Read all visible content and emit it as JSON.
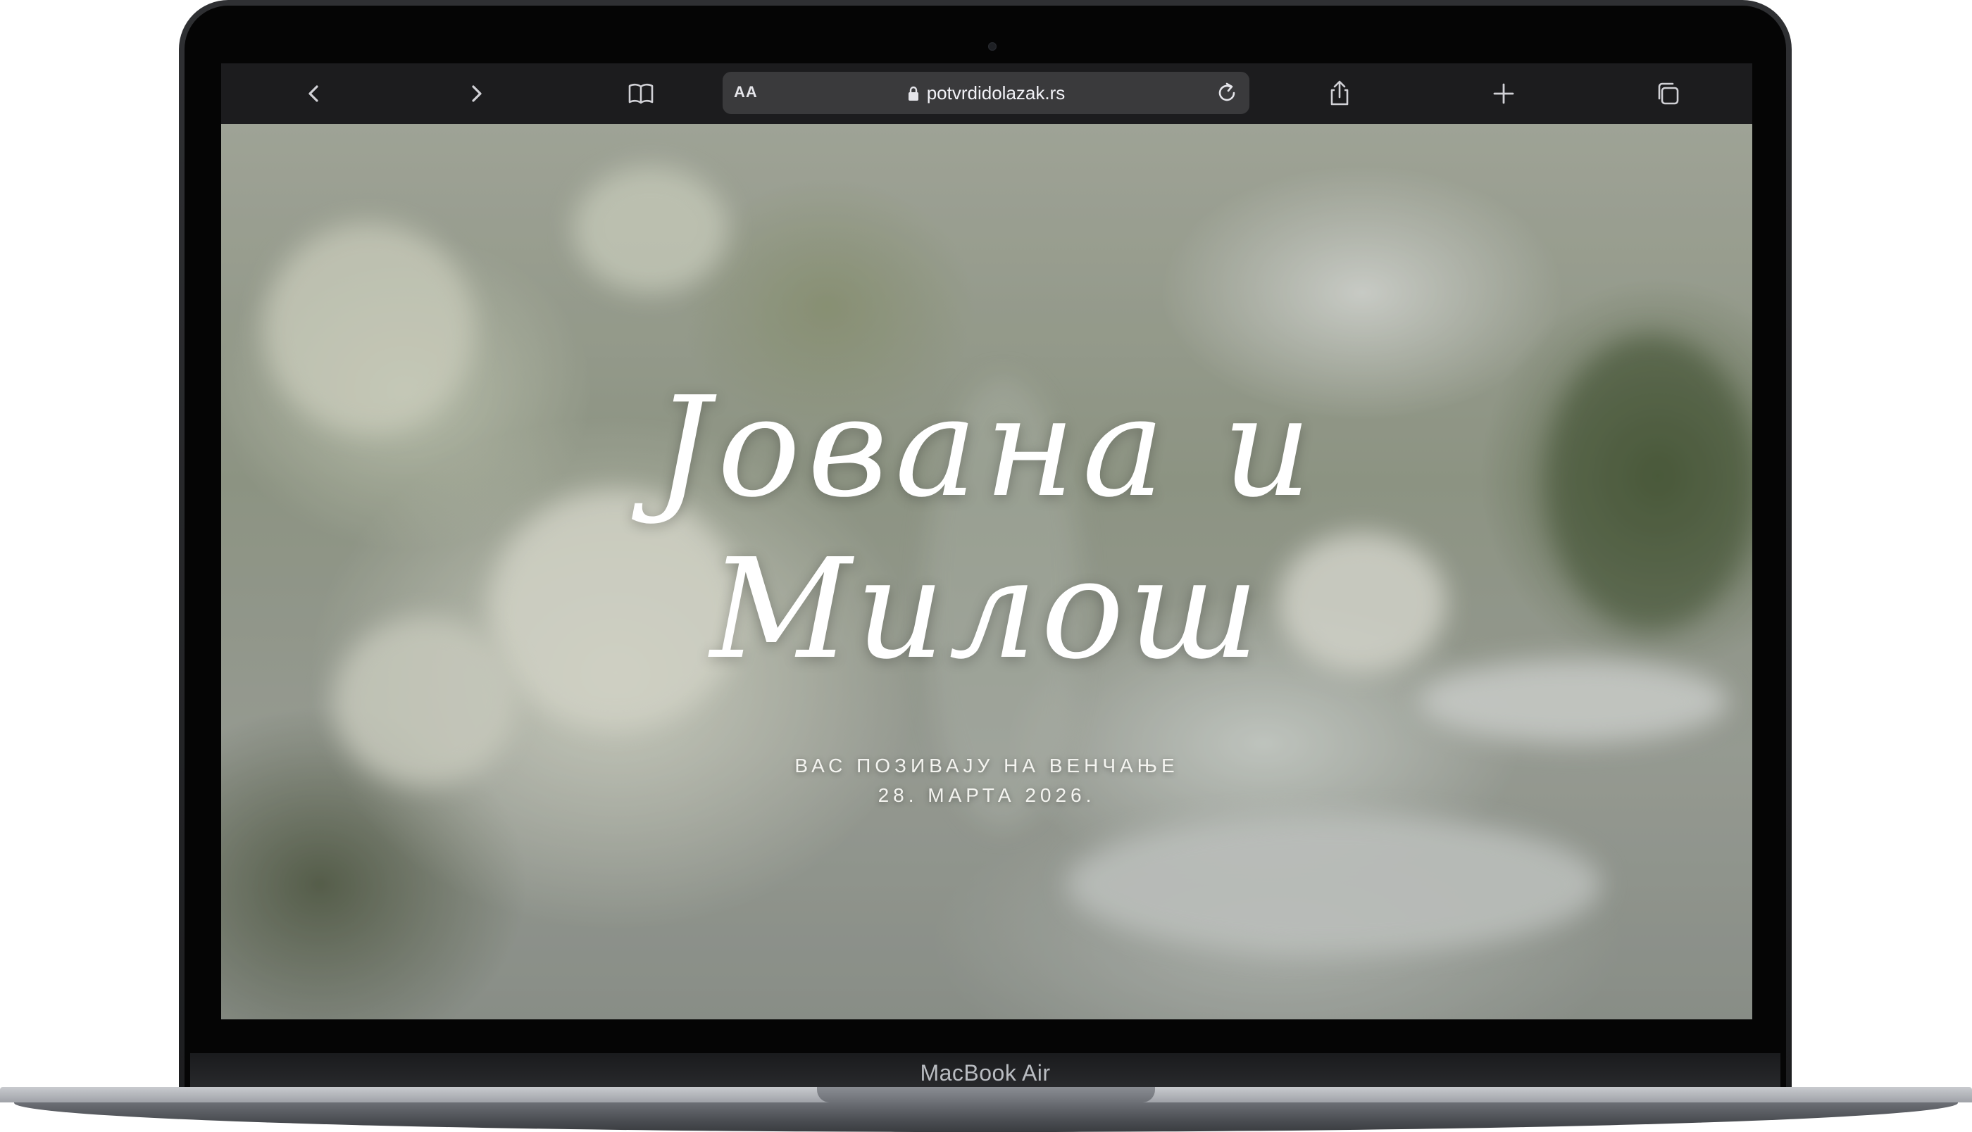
{
  "device": {
    "label": "MacBook Air"
  },
  "browser": {
    "text_size_label": "AA",
    "url": "potvrdidolazak.rs",
    "icons": {
      "back": "chevron-left-icon",
      "forward": "chevron-right-icon",
      "bookmarks": "book-icon",
      "lock": "lock-icon",
      "reload": "reload-icon",
      "share": "share-icon",
      "new_tab": "plus-icon",
      "tabs": "tabs-icon"
    }
  },
  "hero": {
    "names_line1": "Јована и",
    "names_line2": "Милош",
    "invitation": "ВАС ПОЗИВАЈУ НА ВЕНЧАЊЕ",
    "date": "28. МАРТА 2026."
  },
  "colors": {
    "toolbar_bg": "#1c1c1e",
    "url_bar_bg": "#3a3a3c",
    "hero_text": "#ffffff"
  }
}
